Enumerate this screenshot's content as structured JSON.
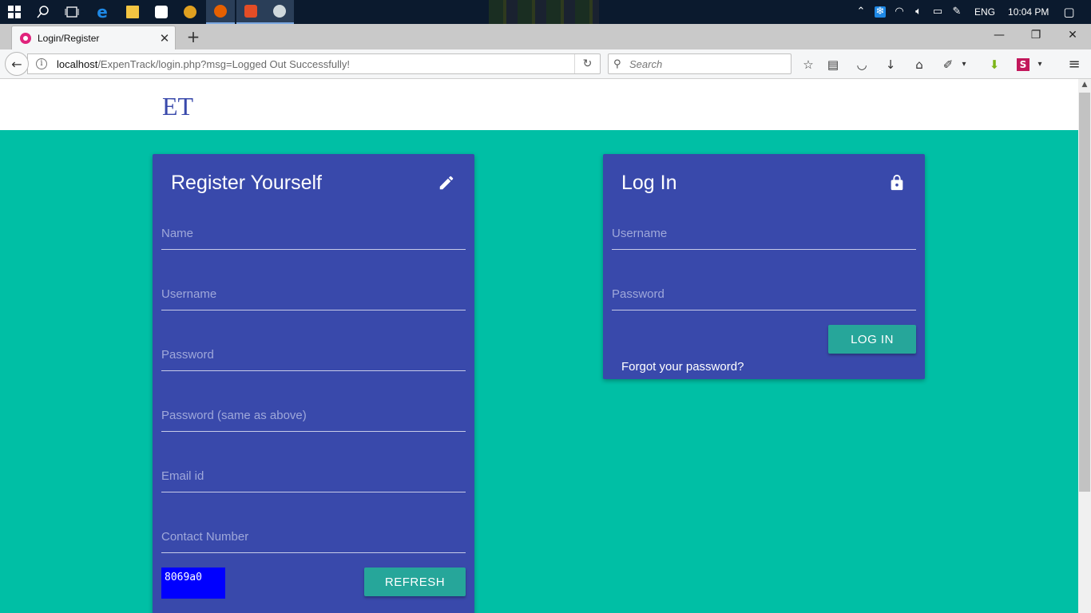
{
  "taskbar": {
    "clock": "10:04 PM",
    "language": "ENG",
    "apps": [
      {
        "name": "start",
        "color": "#ffffff"
      },
      {
        "name": "search",
        "color": "#ffffff"
      },
      {
        "name": "task-view",
        "color": "#ffffff"
      },
      {
        "name": "edge",
        "color": "#1e88e5"
      },
      {
        "name": "file-explorer",
        "color": "#f4c542"
      },
      {
        "name": "store",
        "color": "#ffffff"
      },
      {
        "name": "app-15",
        "color": "#e0a020"
      },
      {
        "name": "firefox",
        "color": "#e66000"
      },
      {
        "name": "html5-app",
        "color": "#e44d26"
      },
      {
        "name": "photos",
        "color": "#cfd8dc"
      }
    ]
  },
  "browser": {
    "tab_title": "Login/Register",
    "url_host": "localhost",
    "url_path": "/ExpenTrack/login.php?msg=Logged Out Successfully!",
    "search_placeholder": "Search"
  },
  "header": {
    "brand": "ET"
  },
  "register": {
    "title": "Register Yourself",
    "fields": {
      "name": "Name",
      "username": "Username",
      "password": "Password",
      "password_confirm": "Password (same as above)",
      "email": "Email id",
      "contact": "Contact Number"
    },
    "captcha_text": "8069a0",
    "refresh_label": "REFRESH"
  },
  "login": {
    "title": "Log In",
    "fields": {
      "username": "Username",
      "password": "Password"
    },
    "login_label": "LOG IN",
    "forgot_label": "Forgot your password?"
  },
  "colors": {
    "accent": "#00bfa5",
    "card": "#3949ab",
    "button": "#26a69a"
  }
}
